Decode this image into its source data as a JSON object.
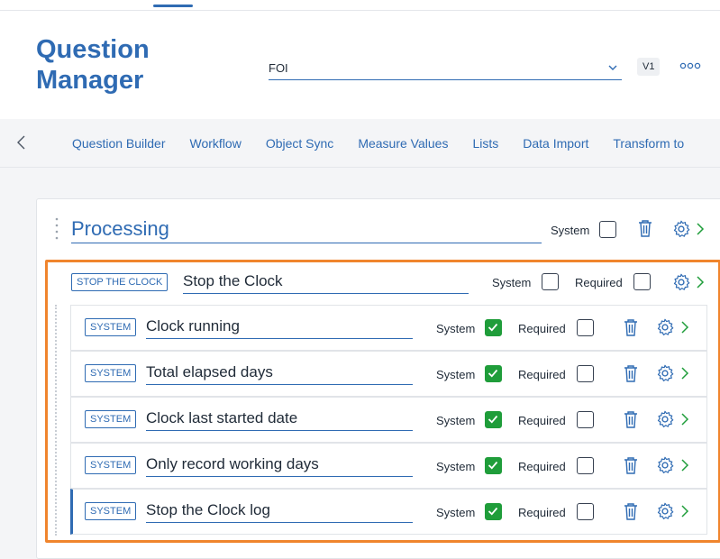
{
  "header": {
    "title": "Question Manager",
    "select_value": "FOI",
    "version": "V1"
  },
  "tabs": [
    {
      "label": "Question Builder"
    },
    {
      "label": "Workflow"
    },
    {
      "label": "Object Sync"
    },
    {
      "label": "Measure Values"
    },
    {
      "label": "Lists"
    },
    {
      "label": "Data Import"
    },
    {
      "label": "Transform to"
    }
  ],
  "section": {
    "title": "Processing",
    "system_label": "System"
  },
  "group": {
    "badge": "STOP THE CLOCK",
    "name": "Stop the Clock",
    "system_label": "System",
    "required_label": "Required"
  },
  "rows": [
    {
      "badge": "SYSTEM",
      "name": "Clock running",
      "system_label": "System",
      "required_label": "Required",
      "system_checked": true,
      "required_checked": false
    },
    {
      "badge": "SYSTEM",
      "name": "Total elapsed days",
      "system_label": "System",
      "required_label": "Required",
      "system_checked": true,
      "required_checked": false
    },
    {
      "badge": "SYSTEM",
      "name": "Clock last started date",
      "system_label": "System",
      "required_label": "Required",
      "system_checked": true,
      "required_checked": false
    },
    {
      "badge": "SYSTEM",
      "name": "Only record working days",
      "system_label": "System",
      "required_label": "Required",
      "system_checked": true,
      "required_checked": false
    },
    {
      "badge": "SYSTEM",
      "name": "Stop the Clock log",
      "system_label": "System",
      "required_label": "Required",
      "system_checked": true,
      "required_checked": false
    }
  ],
  "colors": {
    "accent": "#2f6bb3",
    "highlight": "#f0852d",
    "checked": "#1f9d3a"
  }
}
